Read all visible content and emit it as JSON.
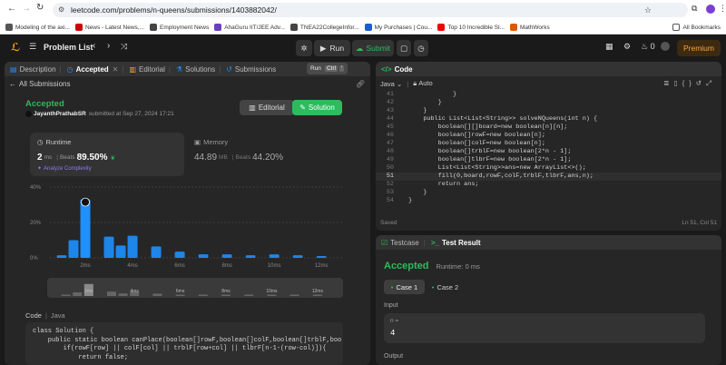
{
  "browser": {
    "url": "leetcode.com/problems/n-queens/submissions/1403882042/",
    "bookmarks": [
      {
        "label": "Modeling of the axi...",
        "color": "#555"
      },
      {
        "label": "News - Latest News,...",
        "color": "#c00"
      },
      {
        "label": "Employment News",
        "color": "#444"
      },
      {
        "label": "AhaGuru IIT/JEE Adv...",
        "color": "#6a3fbf"
      },
      {
        "label": "TNEA22CollegeInfor...",
        "color": "#444"
      },
      {
        "label": "My Purchases | Cou...",
        "color": "#1e5bd8"
      },
      {
        "label": "Top 10 Incredible Sl...",
        "color": "#e00"
      },
      {
        "label": "MathWorks",
        "color": "#d65c00"
      }
    ],
    "all_bookmarks": "All Bookmarks"
  },
  "nav": {
    "problem_list": "Problem List",
    "run": "Run",
    "submit": "Submit",
    "coins": "0",
    "premium": "Premium"
  },
  "left": {
    "tabs": {
      "description": "Description",
      "accepted": "Accepted",
      "editorial": "Editorial",
      "solutions": "Solutions",
      "submissions": "Submissions"
    },
    "tooltip": {
      "label": "Run",
      "key1": "Ctrl",
      "key2": "'"
    },
    "all_submissions": "All Submissions",
    "status": "Accepted",
    "user": "JayanthPrathabSR",
    "submitted": "submitted at Sep 27, 2024 17:21",
    "editorial_btn": "Editorial",
    "solution_btn": "Solution",
    "runtime": {
      "label": "Runtime",
      "value": "2",
      "unit": "ms",
      "beats": "Beats",
      "pct": "89.50%",
      "analyze": "Analyze Complexity"
    },
    "memory": {
      "label": "Memory",
      "value": "44.89",
      "unit": "MB",
      "beats": "Beats",
      "pct": "44.20%"
    },
    "code_label": "Code",
    "lang": "Java",
    "code": [
      "class Solution {",
      "    public static boolean canPlace(boolean[]rowF,boolean[]colF,boolean[]trblF,boo",
      "        if(rowF[row] || colF[col] || trblF[row+col] || tlbrF[n-1-(row-col)]){",
      "            return false;"
    ]
  },
  "chart_data": {
    "type": "bar",
    "y_ticks": [
      "40%",
      "20%",
      "0%"
    ],
    "ylim": [
      0,
      40
    ],
    "x_ticks": [
      "2ms",
      "4ms",
      "6ms",
      "8ms",
      "10ms",
      "12ms"
    ],
    "bars": [
      {
        "x": 1,
        "value": 1.5
      },
      {
        "x": 1.5,
        "value": 10
      },
      {
        "x": 2,
        "value": 33,
        "highlight": true
      },
      {
        "x": 3,
        "value": 12
      },
      {
        "x": 3.5,
        "value": 7
      },
      {
        "x": 4,
        "value": 12.5
      },
      {
        "x": 5,
        "value": 6.5
      },
      {
        "x": 6,
        "value": 3.5
      },
      {
        "x": 7,
        "value": 2
      },
      {
        "x": 8,
        "value": 2
      },
      {
        "x": 9,
        "value": 1.5
      },
      {
        "x": 10,
        "value": 2
      },
      {
        "x": 11,
        "value": 1.5
      },
      {
        "x": 12,
        "value": 1
      }
    ],
    "grid": true,
    "accent": "#1e90ff"
  },
  "editor": {
    "title": "Code",
    "lang": "Java",
    "mode": "Auto",
    "saved": "Saved",
    "cursor": "Ln 51, Col 51",
    "lines": [
      {
        "n": "41",
        "t": "            }"
      },
      {
        "n": "42",
        "t": "        }"
      },
      {
        "n": "43",
        "t": "    }"
      },
      {
        "n": "44",
        "t": "    public List<List<String>> solveNQueens(int n) {"
      },
      {
        "n": "45",
        "t": "        boolean[][]board=new boolean[n][n];"
      },
      {
        "n": "46",
        "t": "        boolean[]rowF=new boolean[n];"
      },
      {
        "n": "47",
        "t": "        boolean[]colF=new boolean[n];"
      },
      {
        "n": "48",
        "t": "        boolean[]trblF=new boolean[2*n - 1];"
      },
      {
        "n": "49",
        "t": "        boolean[]tlbrF=new boolean[2*n - 1];"
      },
      {
        "n": "50",
        "t": "        List<List<String>>ans=new ArrayList<>();"
      },
      {
        "n": "51",
        "t": "        fill(0,board,rowF,colF,trblF,tlbrF,ans,n);"
      },
      {
        "n": "52",
        "t": "        return ans;"
      },
      {
        "n": "53",
        "t": "    }"
      },
      {
        "n": "54",
        "t": "}"
      }
    ]
  },
  "result": {
    "tab_testcase": "Testcase",
    "tab_result": "Test Result",
    "status": "Accepted",
    "runtime": "Runtime: 0 ms",
    "case1": "Case 1",
    "case2": "Case 2",
    "input_label": "Input",
    "var": "n =",
    "val": "4",
    "output_label": "Output"
  }
}
